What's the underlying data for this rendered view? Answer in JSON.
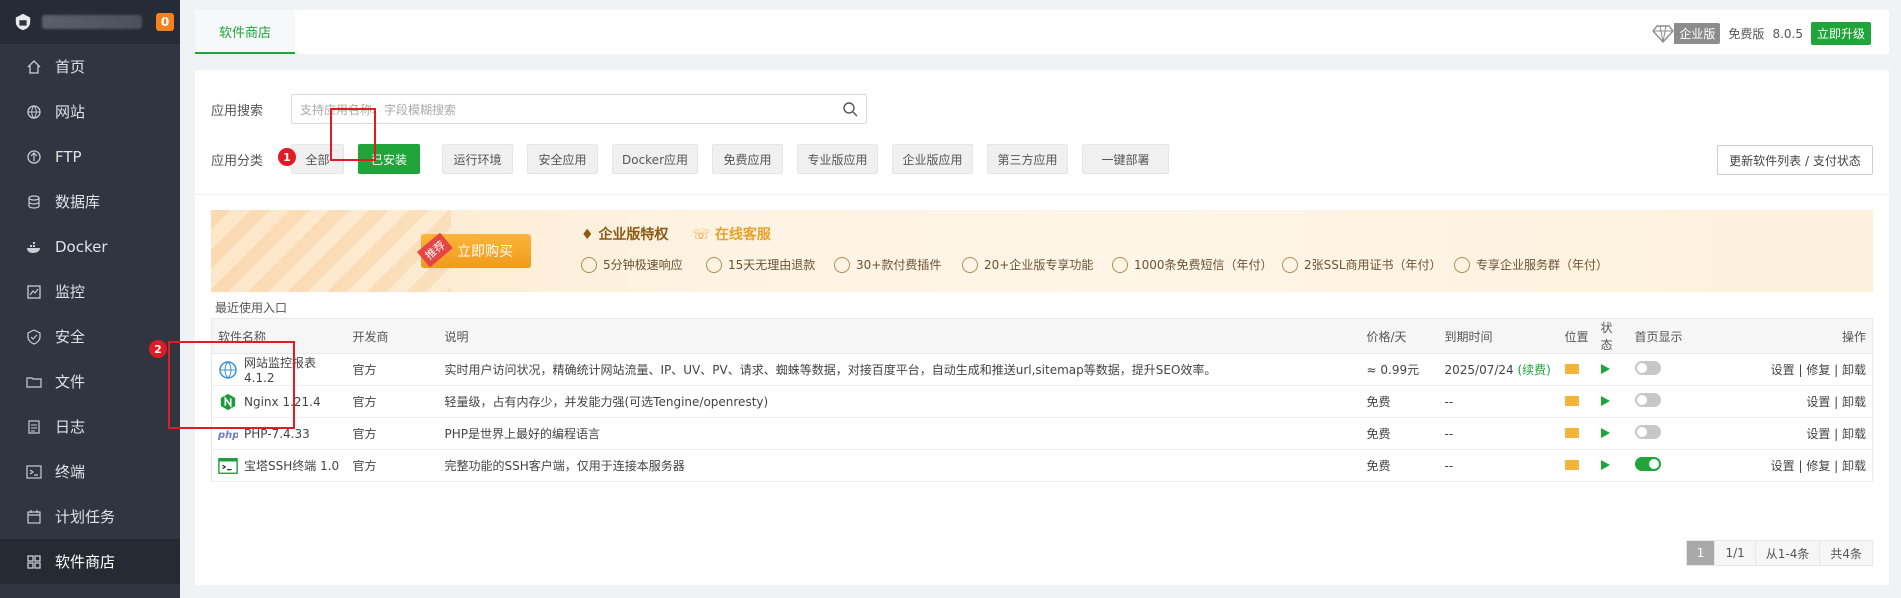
{
  "sidebar": {
    "badge": "0",
    "items": [
      {
        "label": "首页",
        "icon": "home-icon"
      },
      {
        "label": "网站",
        "icon": "globe-icon"
      },
      {
        "label": "FTP",
        "icon": "ftp-icon"
      },
      {
        "label": "数据库",
        "icon": "database-icon"
      },
      {
        "label": "Docker",
        "icon": "docker-icon"
      },
      {
        "label": "监控",
        "icon": "monitor-icon"
      },
      {
        "label": "安全",
        "icon": "shield-icon"
      },
      {
        "label": "文件",
        "icon": "folder-icon"
      },
      {
        "label": "日志",
        "icon": "log-icon"
      },
      {
        "label": "终端",
        "icon": "terminal-icon"
      },
      {
        "label": "计划任务",
        "icon": "calendar-icon"
      },
      {
        "label": "软件商店",
        "icon": "grid-icon"
      }
    ]
  },
  "topbar": {
    "tab": "软件商店",
    "edition_label": "企业版",
    "free_label": "免费版",
    "version": "8.0.5",
    "upgrade": "立即升级"
  },
  "search": {
    "label": "应用搜索",
    "placeholder": "支持应用名称、字段模糊搜索"
  },
  "categories": {
    "label": "应用分类",
    "items": [
      "全部",
      "已安装",
      "运行环境",
      "安全应用",
      "Docker应用",
      "免费应用",
      "专业版应用",
      "企业版应用",
      "第三方应用",
      "一键部署"
    ],
    "refresh": "更新软件列表 / 支付状态"
  },
  "annotations": {
    "one": "1",
    "two": "2"
  },
  "banner": {
    "recommend": "推荐",
    "buy": "立即购买",
    "title": "企业版特权",
    "service": "在线客服",
    "features": [
      "5分钟极速响应",
      "15天无理由退款",
      "30+款付费插件",
      "20+企业版专享功能",
      "1000条免费短信（年付）",
      "2张SSL商用证书（年付）",
      "专享企业服务群（年付）"
    ]
  },
  "recent": "最近使用入口",
  "table": {
    "headers": [
      "软件名称",
      "开发商",
      "说明",
      "价格/天",
      "到期时间",
      "位置",
      "状态",
      "首页显示",
      "操作"
    ],
    "rows": [
      {
        "name": "网站监控报表 4.1.2",
        "dev": "官方",
        "desc": "实时用户访问状况，精确统计网站流量、IP、UV、PV、请求、蜘蛛等数据，对接百度平台，自动生成和推送url,sitemap等数据，提升SEO效率。",
        "price": "≈ 0.99元",
        "expire": "2025/07/24",
        "renew": "(续费)",
        "ops": "设置 | 修复 | 卸载"
      },
      {
        "name": "Nginx 1.21.4",
        "dev": "官方",
        "desc": "轻量级，占有内存少，并发能力强(可选Tengine/openresty)",
        "price": "免费",
        "expire": "--",
        "renew": "",
        "ops": "设置 | 卸载"
      },
      {
        "name": "PHP-7.4.33",
        "dev": "官方",
        "desc": "PHP是世界上最好的编程语言",
        "price": "免费",
        "expire": "--",
        "renew": "",
        "ops": "设置 | 卸载"
      },
      {
        "name": "宝塔SSH终端 1.0",
        "dev": "官方",
        "desc": "完整功能的SSH客户端，仅用于连接本服务器",
        "price": "免费",
        "expire": "--",
        "renew": "",
        "ops": "设置 | 修复 | 卸载"
      }
    ]
  },
  "pager": {
    "current": "1",
    "pages": "1/1",
    "range": "从1-4条",
    "total": "共4条"
  }
}
